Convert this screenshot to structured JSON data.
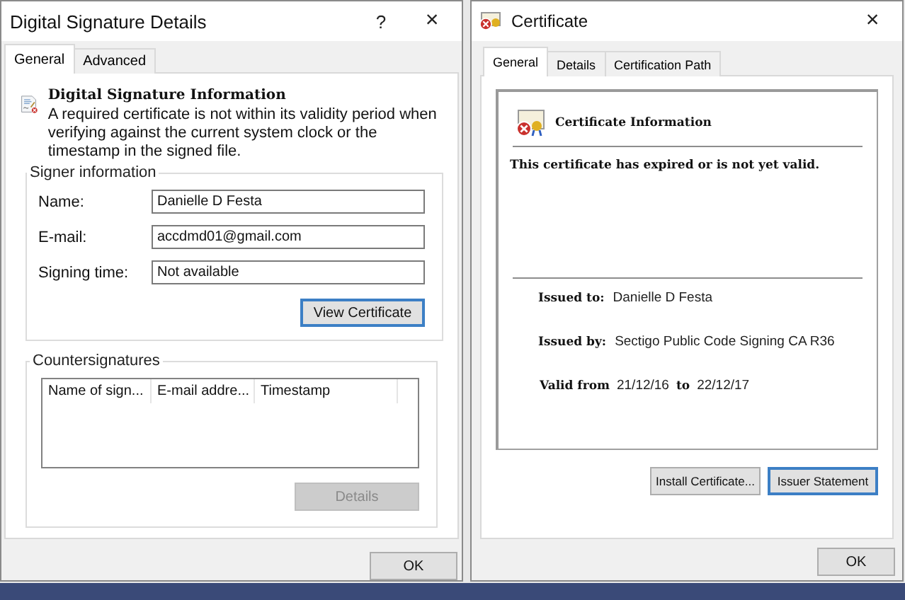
{
  "signature_window": {
    "title": "Digital Signature Details",
    "help": "?",
    "close": "×",
    "tabs": [
      {
        "label": "General",
        "selected": true
      },
      {
        "label": "Advanced",
        "selected": false
      }
    ],
    "info_heading": "Digital Signature Information",
    "info_message": "A required certificate is not within its validity period when verifying against the current system clock or the timestamp in the signed file.",
    "signer_group": {
      "legend": "Signer information",
      "fields": [
        {
          "label": "Name:",
          "value": "Danielle D Festa"
        },
        {
          "label": "E-mail:",
          "value": "accdmd01@gmail.com"
        },
        {
          "label": "Signing time:",
          "value": "Not available"
        }
      ],
      "button": {
        "label": "View Certificate",
        "disabled": false,
        "focused": true
      }
    },
    "countersignatures": {
      "legend": "Countersignatures",
      "columns": [
        "Name of sign...",
        "E-mail addre...",
        "Timestamp"
      ],
      "button": {
        "label": "Details",
        "disabled": true,
        "focused": false
      }
    },
    "ok": "OK"
  },
  "certificate_window": {
    "title": "Certificate",
    "close": "×",
    "tabs": [
      {
        "label": "General",
        "selected": true
      },
      {
        "label": "Details",
        "selected": false
      },
      {
        "label": "Certification Path",
        "selected": false
      }
    ],
    "heading": "Certificate Information",
    "status": "This certificate has expired or is not yet valid.",
    "issued_to": {
      "label": "Issued to:",
      "value": "Danielle D Festa"
    },
    "issued_by": {
      "label": "Issued by:",
      "value": "Sectigo Public Code Signing CA R36"
    },
    "validity": {
      "label": "Valid from",
      "from": "21/12/16",
      "separator": "to",
      "to": "22/12/17"
    },
    "buttons": [
      {
        "label": "Install Certificate...",
        "focused": false
      },
      {
        "label": "Issuer Statement",
        "focused": true
      }
    ],
    "ok": "OK"
  }
}
